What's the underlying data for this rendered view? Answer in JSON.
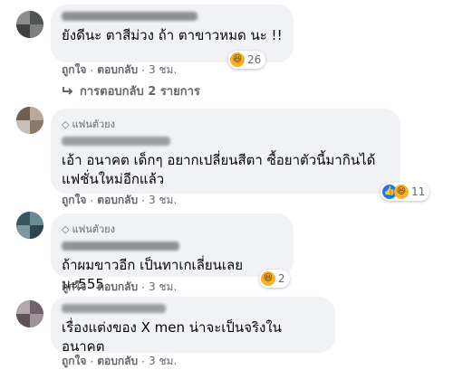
{
  "colors": {
    "bubble": "#f0f2f5",
    "secondary_text": "#65676b",
    "like_blue": "#1877f2",
    "haha_yellow": "#f7b125"
  },
  "comments": [
    {
      "fan_badge": "",
      "text": "ยังดีนะ ตาสีม่วง ถ้า ตาขาวหมด นะ !!",
      "like_label": "ถูกใจ",
      "reply_label": "ตอบกลับ",
      "time": "3 ชม.",
      "reaction_icons": [
        "haha-icon"
      ],
      "reaction_count": "26",
      "replies_link": "การตอบกลับ 2 รายการ"
    },
    {
      "fan_badge": "แฟนตัวยง",
      "text": "เอ้า อนาคต เด็กๆ อยากเปลี่ยนสีตา ซื้อยาตัวนี้มากินได้แฟชั่นใหม่อีกแล้ว",
      "like_label": "ถูกใจ",
      "reply_label": "ตอบกลับ",
      "time": "3 ชม.",
      "reaction_icons": [
        "like-icon",
        "haha-icon"
      ],
      "reaction_count": "11"
    },
    {
      "fan_badge": "แฟนตัวยง",
      "text": "ถ้าผมขาวอีก เป็นทาเกเลี่ยนเลยนะ555",
      "like_label": "ถูกใจ",
      "reply_label": "ตอบกลับ",
      "time": "3 ชม.",
      "reaction_icons": [
        "haha-icon"
      ],
      "reaction_count": "2"
    },
    {
      "fan_badge": "",
      "text": "เรื่องแต่งของ X men น่าจะเป็นจริงในอนาคต",
      "like_label": "ถูกใจ",
      "reply_label": "ตอบกลับ",
      "time": "3 ชม."
    }
  ]
}
